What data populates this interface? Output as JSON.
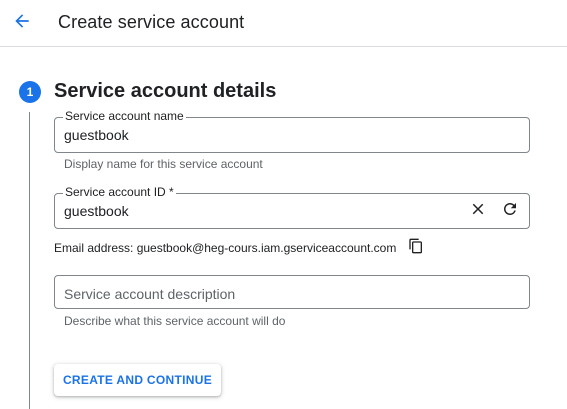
{
  "header": {
    "title": "Create service account",
    "back_icon": "arrow-back-icon",
    "accent": "#1a73e8"
  },
  "step": {
    "number": "1",
    "title": "Service account details"
  },
  "fields": {
    "name": {
      "label": "Service account name",
      "value": "guestbook",
      "helper": "Display name for this service account"
    },
    "id": {
      "label": "Service account ID *",
      "value": "guestbook",
      "clear_icon": "close-icon",
      "regenerate_icon": "refresh-icon"
    },
    "description": {
      "placeholder": "Service account description",
      "helper": "Describe what this service account will do"
    }
  },
  "email": {
    "text": "Email address: guestbook@heg-cours.iam.gserviceaccount.com",
    "copy_icon": "copy-icon"
  },
  "actions": {
    "create_label": "CREATE AND CONTINUE"
  }
}
